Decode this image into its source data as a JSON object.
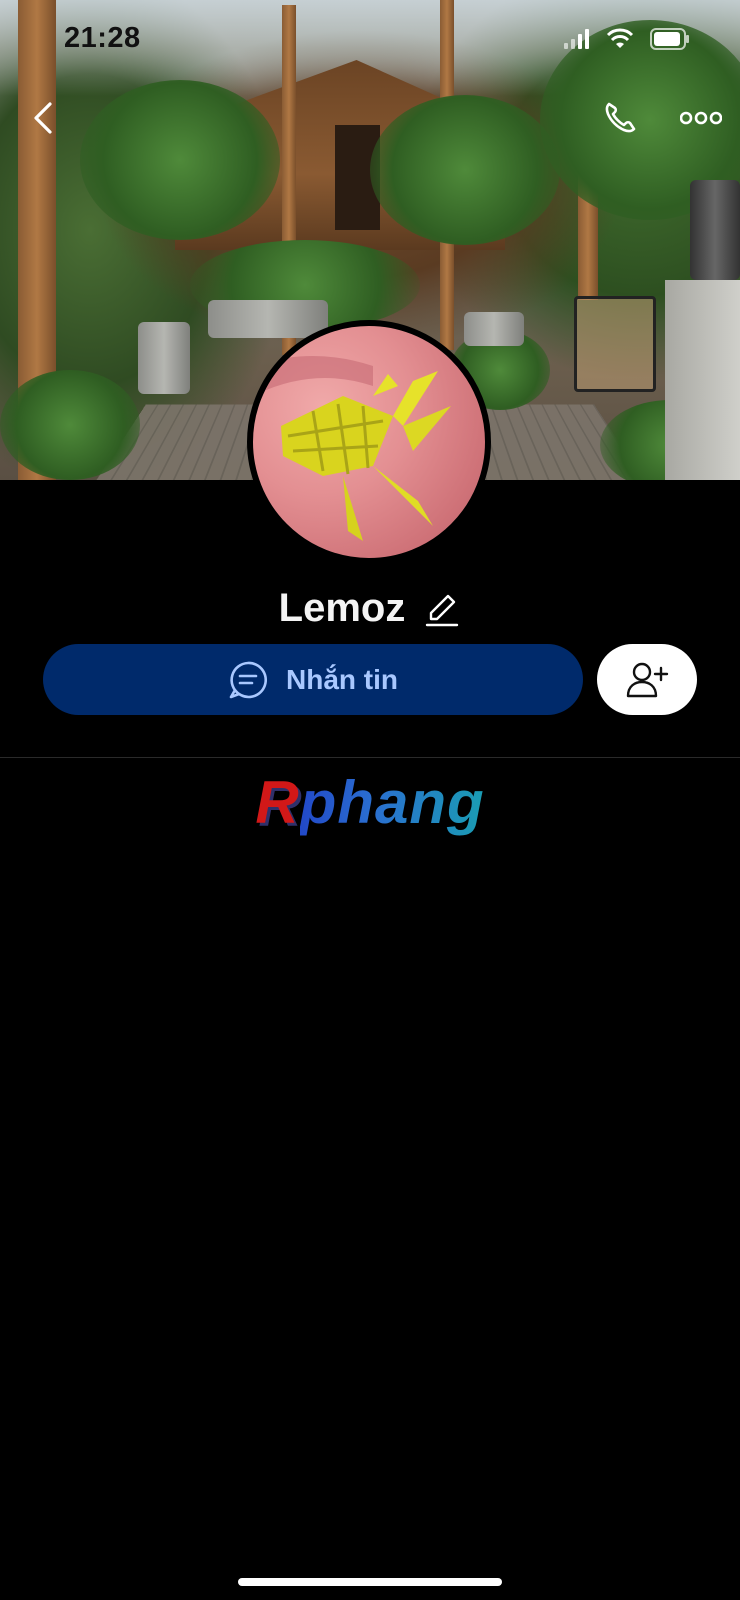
{
  "status": {
    "time": "21:28"
  },
  "profile": {
    "name": "Lemoz"
  },
  "actions": {
    "message_label": "Nhắn tin"
  },
  "watermark": {
    "first": "R",
    "rest": "phang"
  },
  "colors": {
    "primary_button": "#002a6b",
    "primary_text": "#a9c8ff",
    "background": "#000000"
  },
  "icons": [
    "back-icon",
    "phone-icon",
    "more-icon",
    "edit-icon",
    "chat-icon",
    "add-friend-icon",
    "wifi-icon",
    "signal-icon",
    "battery-icon"
  ]
}
